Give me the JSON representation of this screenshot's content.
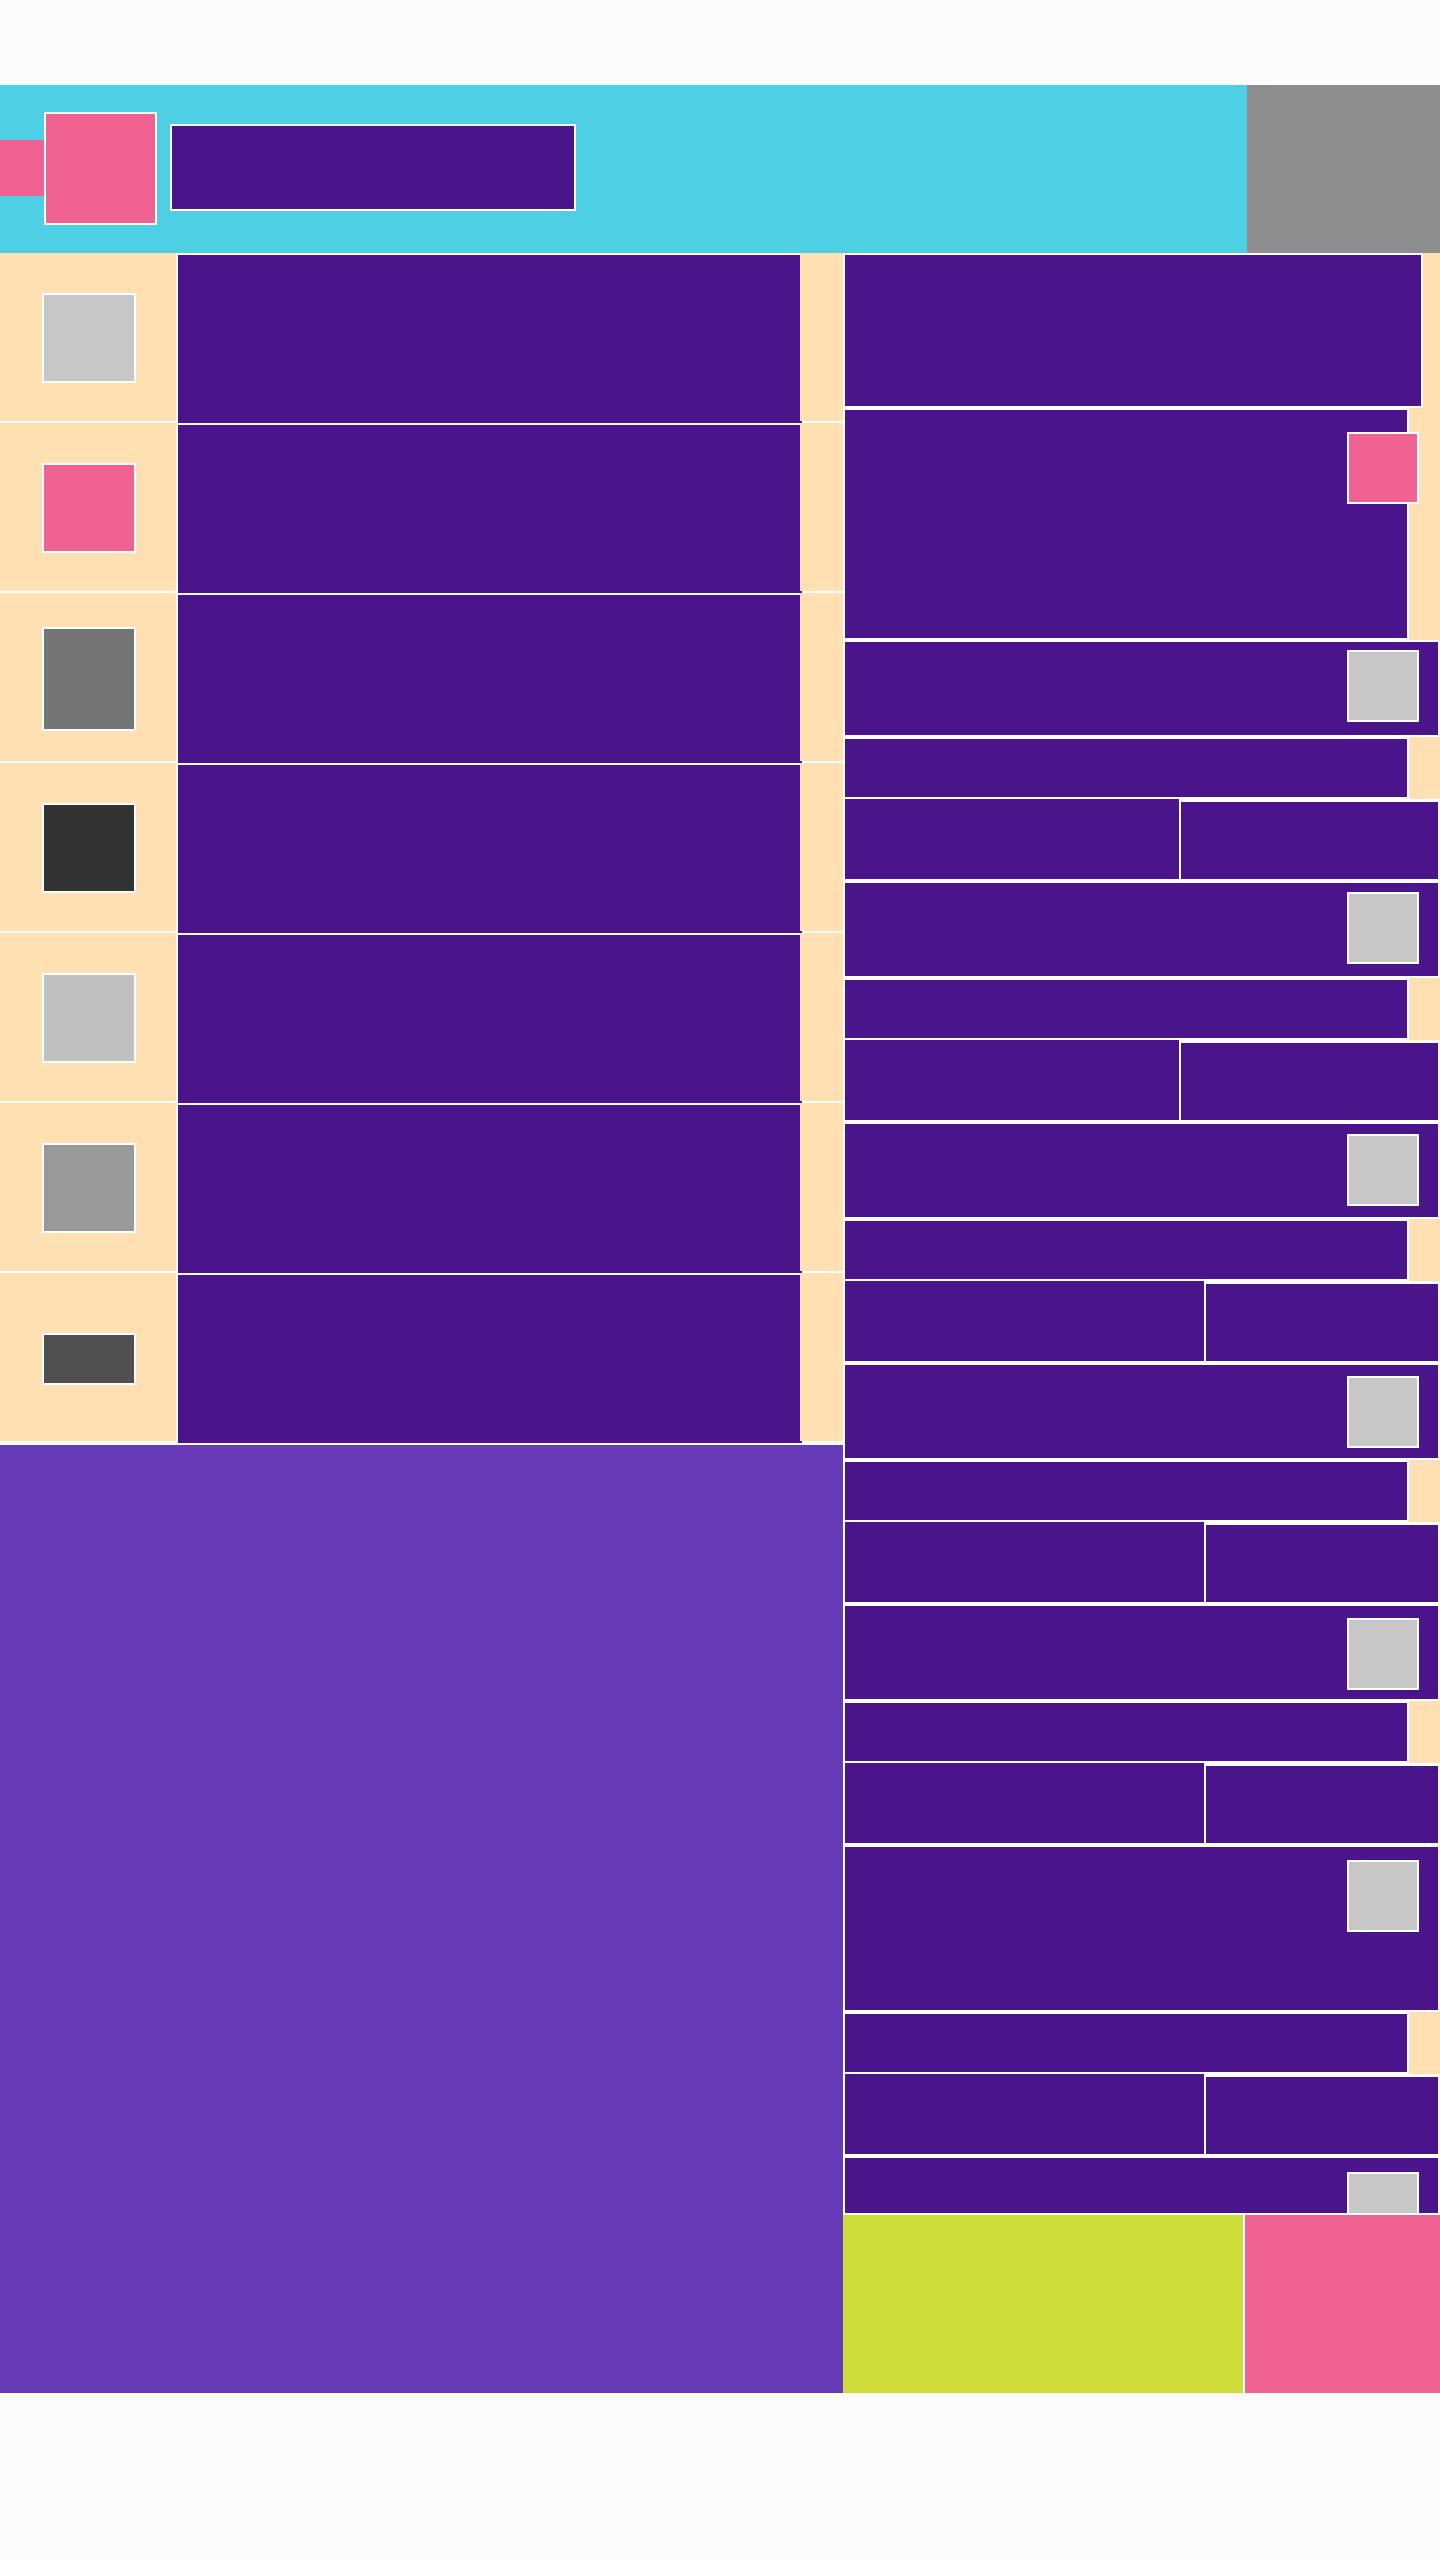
{
  "colors": {
    "background": "#fcfcfc",
    "header": "#4ecfe3",
    "gray_panel": "#8e8e8e",
    "item": "#4a148a",
    "cream": "#ffe0b3",
    "pink": "#f06292",
    "purple_panel": "#673ab7",
    "lime": "#cddc39",
    "white": "#ffffff"
  },
  "header": {
    "logo_icon": "pink-square-icon",
    "title": ""
  },
  "list": {
    "items": [
      {
        "label": "",
        "thumb_color": "#c7c7c7",
        "thumb_icon": "light-gray-square-icon"
      },
      {
        "label": "",
        "thumb_color": "#f06292",
        "thumb_icon": "pink-square-icon"
      },
      {
        "label": "",
        "thumb_color": "#757575",
        "thumb_icon": "gray-square-icon"
      },
      {
        "label": "",
        "thumb_color": "#333333",
        "thumb_icon": "dark-square-icon"
      },
      {
        "label": "",
        "thumb_color": "#c0c0c0",
        "thumb_icon": "light-gray-square-icon"
      },
      {
        "label": "",
        "thumb_color": "#999999",
        "thumb_icon": "gray-square-icon"
      },
      {
        "label": "",
        "thumb_color": "#505050",
        "thumb_icon": "dark-gray-bar-icon"
      }
    ]
  },
  "right_column": {
    "blocks": [
      {
        "label": ""
      },
      {
        "label": ""
      },
      {
        "label": ""
      },
      {
        "label": ""
      },
      {
        "label": ""
      },
      {
        "label": ""
      },
      {
        "label": ""
      },
      {
        "label": ""
      },
      {
        "label": ""
      },
      {
        "label": ""
      },
      {
        "label": ""
      },
      {
        "label": ""
      },
      {
        "label": ""
      },
      {
        "label": ""
      },
      {
        "label": ""
      },
      {
        "label": ""
      },
      {
        "label": ""
      },
      {
        "label": ""
      },
      {
        "label": ""
      },
      {
        "label": ""
      },
      {
        "label": ""
      },
      {
        "label": ""
      },
      {
        "label": ""
      },
      {
        "label": ""
      },
      {
        "label": ""
      },
      {
        "label": ""
      },
      {
        "label": ""
      },
      {
        "label": ""
      },
      {
        "label": ""
      },
      {
        "label": ""
      },
      {
        "label": ""
      }
    ],
    "thumb_icon": "light-gray-square-icon"
  },
  "footer": {
    "left_label": "",
    "right_label": ""
  }
}
